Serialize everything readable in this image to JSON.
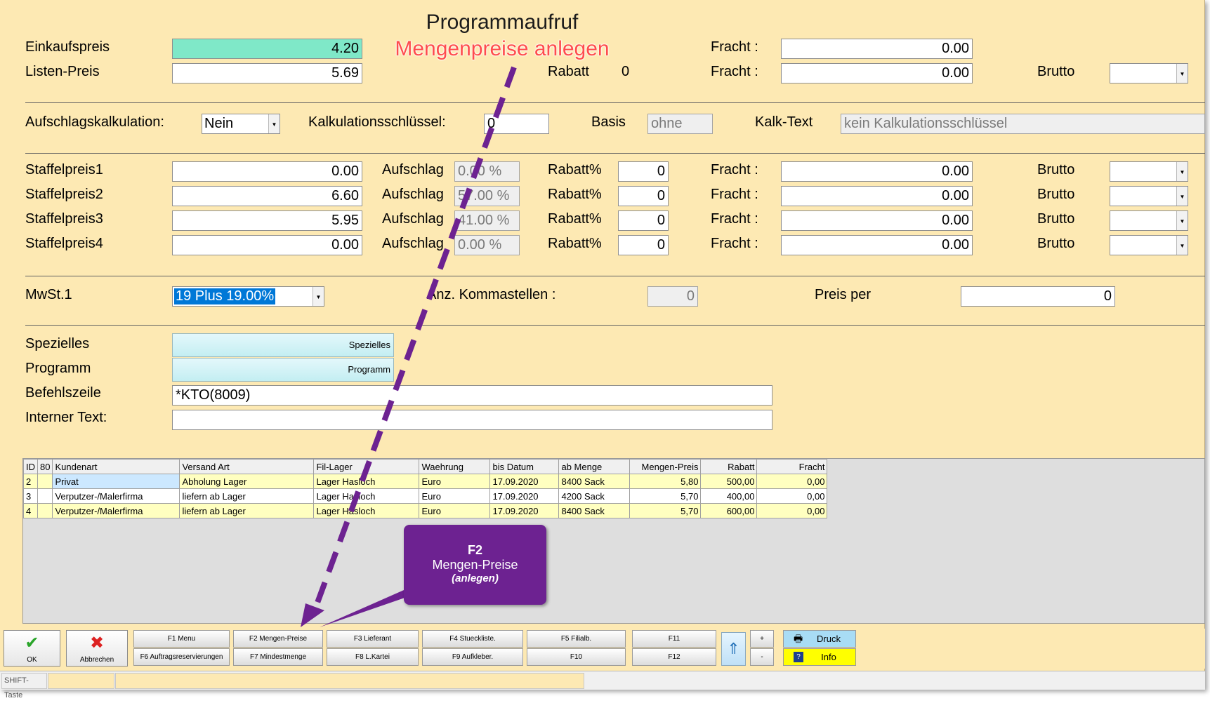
{
  "annotation": {
    "title": "Programmaufruf",
    "subtitle": "Mengenpreise anlegen",
    "callout_key": "F2",
    "callout_label": "Mengen-Preise",
    "callout_note": "(anlegen)"
  },
  "form": {
    "einkaufspreis_label": "Einkaufspreis",
    "einkaufspreis_value": "4.20",
    "listenpreis_label": "Listen-Preis",
    "listenpreis_value": "5.69",
    "rabatt_label": "Rabatt",
    "rabatt_value": "0",
    "fracht_label": "Fracht :",
    "fracht1_value": "0.00",
    "fracht2_value": "0.00",
    "brutto_label": "Brutto",
    "aufschlagskalk_label": "Aufschlagskalkulation:",
    "aufschlagskalk_value": "Nein",
    "kalkschluessel_label": "Kalkulationsschlüssel:",
    "kalkschluessel_value": "0",
    "basis_label": "Basis",
    "basis_value": "ohne",
    "kalktext_label": "Kalk-Text",
    "kalktext_value": "kein Kalkulationsschlüssel",
    "staffel_rows": [
      {
        "label": "Staffelpreis1",
        "price": "0.00",
        "aufschlag_label": "Aufschlag",
        "aufschlag": "0.00 %",
        "rabatt_label": "Rabatt%",
        "rabatt": "0",
        "fracht_label": "Fracht :",
        "fracht": "0.00",
        "brutto_label": "Brutto"
      },
      {
        "label": "Staffelpreis2",
        "price": "6.60",
        "aufschlag_label": "Aufschlag",
        "aufschlag": "57.00 %",
        "rabatt_label": "Rabatt%",
        "rabatt": "0",
        "fracht_label": "Fracht :",
        "fracht": "0.00",
        "brutto_label": "Brutto"
      },
      {
        "label": "Staffelpreis3",
        "price": "5.95",
        "aufschlag_label": "Aufschlag",
        "aufschlag": "41.00 %",
        "rabatt_label": "Rabatt%",
        "rabatt": "0",
        "fracht_label": "Fracht :",
        "fracht": "0.00",
        "brutto_label": "Brutto"
      },
      {
        "label": "Staffelpreis4",
        "price": "0.00",
        "aufschlag_label": "Aufschlag",
        "aufschlag": "0.00 %",
        "rabatt_label": "Rabatt%",
        "rabatt": "0",
        "fracht_label": "Fracht :",
        "fracht": "0.00",
        "brutto_label": "Brutto"
      }
    ],
    "mwst_label": "MwSt.1",
    "mwst_value": "19 Plus 19.00%",
    "kommastellen_label": "Anz. Kommastellen :",
    "kommastellen_value": "0",
    "preisper_label": "Preis per",
    "preisper_value": "0",
    "speziell_label": "Spezielles",
    "speziell_button": "Spezielles",
    "programm_label": "Programm",
    "programm_button": "Programm",
    "befehl_label": "Befehlszeile",
    "befehl_value": "*KTO(8009)",
    "interner_label": "Interner Text:",
    "interner_value": ""
  },
  "table": {
    "columns": [
      "ID",
      "80",
      "Kundenart",
      "Versand Art",
      "Fil-Lager",
      "Waehrung",
      "bis Datum",
      "ab Menge",
      "Mengen-Preis",
      "Rabatt",
      "Fracht"
    ],
    "rows": [
      [
        "2",
        "",
        "Privat",
        "Abholung Lager",
        "Lager Hasloch",
        "Euro",
        "17.09.2020",
        "8400  Sack",
        "5,80",
        "500,00",
        "0,00"
      ],
      [
        "3",
        "",
        "Verputzer-/Malerfirma",
        "liefern ab Lager",
        "Lager Hasloch",
        "Euro",
        "17.09.2020",
        "4200  Sack",
        "5,70",
        "400,00",
        "0,00"
      ],
      [
        "4",
        "",
        "Verputzer-/Malerfirma",
        "liefern ab Lager",
        "Lager Hasloch",
        "Euro",
        "17.09.2020",
        "8400  Sack",
        "5,70",
        "600,00",
        "0,00"
      ]
    ]
  },
  "toolbar": {
    "ok": "OK",
    "abbrechen": "Abbrechen",
    "f1": "F1 Menu",
    "f6": "F6 Auftragsreservierungen",
    "f2": "F2 Mengen-Preise",
    "f7": "F7 Mindestmenge",
    "f3": "F3 Lieferant",
    "f8": "F8 L.Kartei",
    "f4": "F4 Stueckliste.",
    "f9": "F9 Aufkleber.",
    "f5": "F5 Filialb.",
    "f10": "F10",
    "f11": "F11",
    "f12": "F12",
    "plus": "+",
    "minus": "-",
    "druck": "Druck",
    "info": "Info"
  },
  "status": {
    "shift": "SHIFT-Taste"
  },
  "colors": {
    "window_bg": "#fde9b3",
    "highlight_input": "#7fe8c8",
    "arrow": "#6d2291",
    "subtitle": "#ff4c4c",
    "info_bg": "#ffff00",
    "druck_bg": "#a8dcf5"
  }
}
